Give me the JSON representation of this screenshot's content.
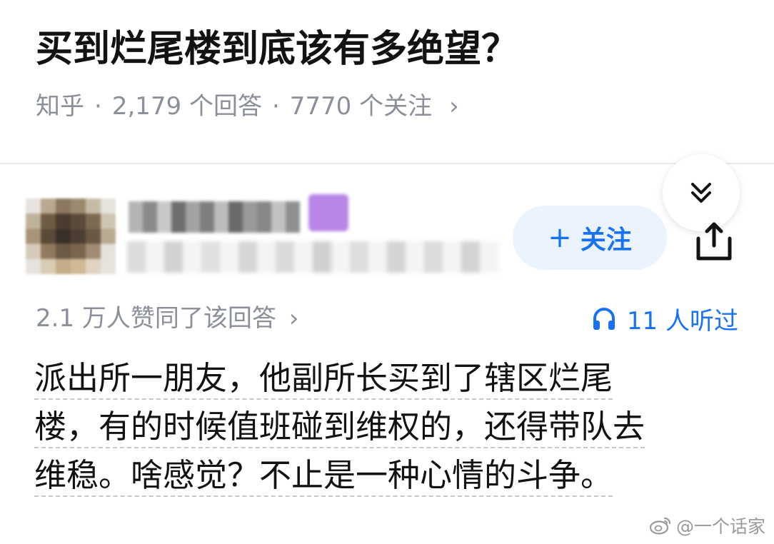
{
  "question": {
    "title": "买到烂尾楼到底该有多绝望？",
    "source": "知乎",
    "answer_count": "2,179 个回答",
    "follower_count": "7770 个关注",
    "chevron": "›"
  },
  "author": {
    "follow_label": "关注",
    "follow_plus": "+"
  },
  "stats": {
    "voteup_text": "2.1 万人赞同了该回答",
    "chevron": "›",
    "listen_text": "11 人听过"
  },
  "answer": {
    "lines": [
      "派出所一朋友，他副所长买到了辖区烂尾",
      "楼，有的时候值班碰到维权的，还得带队去",
      "维稳。啥感觉？不止是一种心情的斗争。"
    ]
  },
  "watermark": {
    "text": "@一个话家"
  },
  "colors": {
    "accent": "#1772f6",
    "follow_bg": "#ebf3fe",
    "meta_gray": "#8a8f99",
    "text": "#121212",
    "badge_purple": "#b886e6"
  },
  "icons": {
    "collapse": "chevron-double-down-icon",
    "share": "share-icon",
    "headphones": "headphones-icon",
    "weibo": "weibo-icon"
  }
}
